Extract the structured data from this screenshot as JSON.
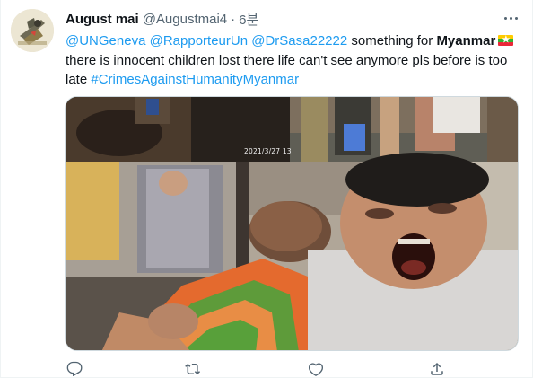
{
  "tweet": {
    "author_name": "August mai",
    "author_handle": "@Augustmai4",
    "separator": "·",
    "time": "6분",
    "text": {
      "mention_1": "@UNGeneva",
      "mention_2": "@RapporteurUn",
      "mention_3": "@DrSasa22222",
      "body_1": "something for",
      "country": "Myanmar",
      "flag_star": "★",
      "body_2": "there is innocent children lost there life can't see anymore pls before is too late",
      "hashtag": "#CrimesAgainstHumanityMyanmar"
    },
    "media": {
      "timestamp_overlay": "2021/3/27  13"
    }
  },
  "icons": {
    "more": "more-icon",
    "reply": "reply-icon",
    "retweet": "retweet-icon",
    "like": "heart-icon",
    "share": "share-icon"
  },
  "colors": {
    "link": "#1d9bf0",
    "text": "#0f1419",
    "secondary": "#536471"
  }
}
